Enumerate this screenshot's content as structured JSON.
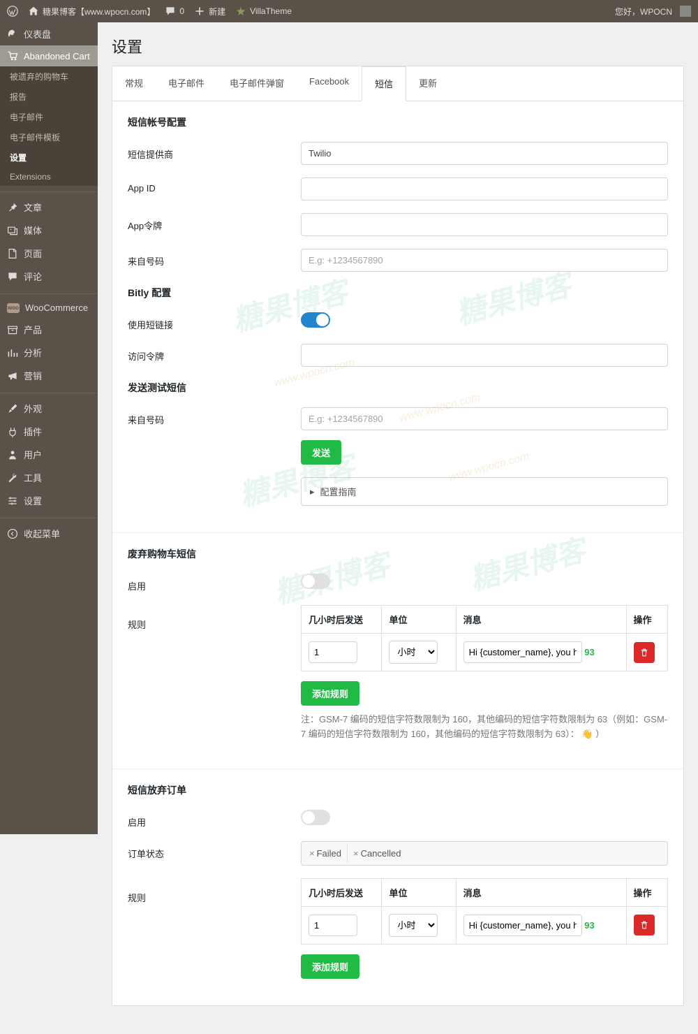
{
  "topbar": {
    "site_name": "糖果博客【www.wpocn.com】",
    "comments": "0",
    "new": "新建",
    "villatheme": "VillaTheme",
    "greeting": "您好，WPOCN"
  },
  "sidebar": {
    "dashboard": "仪表盘",
    "abandoned_cart": "Abandoned Cart",
    "sub_abandoned": "被遗弃的购物车",
    "sub_reports": "报告",
    "sub_email": "电子邮件",
    "sub_email_tpl": "电子邮件模板",
    "sub_settings": "设置",
    "sub_extensions": "Extensions",
    "posts": "文章",
    "media": "媒体",
    "pages": "页面",
    "comments": "评论",
    "woocommerce": "WooCommerce",
    "products": "产品",
    "analytics": "分析",
    "marketing": "营销",
    "appearance": "外观",
    "plugins": "插件",
    "users": "用户",
    "tools": "工具",
    "settings": "设置",
    "collapse": "收起菜单"
  },
  "page": {
    "title": "设置"
  },
  "tabs": {
    "general": "常规",
    "email": "电子邮件",
    "email_popup": "电子邮件弹窗",
    "facebook": "Facebook",
    "sms": "短信",
    "update": "更新"
  },
  "sms_account": {
    "title": "短信帐号配置",
    "provider_label": "短信提供商",
    "provider_value": "Twilio",
    "app_id_label": "App ID",
    "app_token_label": "App令牌",
    "from_number_label": "来自号码",
    "from_placeholder": "E.g: +1234567890"
  },
  "bitly": {
    "title": "Bitly 配置",
    "shortlink_label": "使用短链接",
    "token_label": "访问令牌"
  },
  "test_sms": {
    "title": "发送测试短信",
    "from_label": "来自号码",
    "from_placeholder": "E.g: +1234567890",
    "send_btn": "发送",
    "guide": "配置指南"
  },
  "abandoned_sms": {
    "title": "废弃购物车短信",
    "enable_label": "启用",
    "rules_label": "规则",
    "col_hours": "几小时后发送",
    "col_unit": "单位",
    "col_msg": "消息",
    "col_action": "操作",
    "hours_value": "1",
    "unit_value": "小时",
    "msg_value": "Hi {customer_name}, you have",
    "char_count": "93",
    "add_rule": "添加规则",
    "note": "注：GSM-7 编码的短信字符数限制为 160，其他编码的短信字符数限制为 63（例如：GSM-7 编码的短信字符数限制为 160，其他编码的短信字符数限制为 63）： 👋 ）"
  },
  "abandoned_order": {
    "title": "短信放弃订单",
    "enable_label": "启用",
    "status_label": "订单状态",
    "tag_failed": "Failed",
    "tag_cancelled": "Cancelled",
    "rules_label": "规则",
    "col_hours": "几小时后发送",
    "col_unit": "单位",
    "col_msg": "消息",
    "col_action": "操作",
    "hours_value": "1",
    "unit_value": "小时",
    "msg_value": "Hi {customer_name}, you have",
    "char_count": "93",
    "add_rule": "添加规则"
  }
}
